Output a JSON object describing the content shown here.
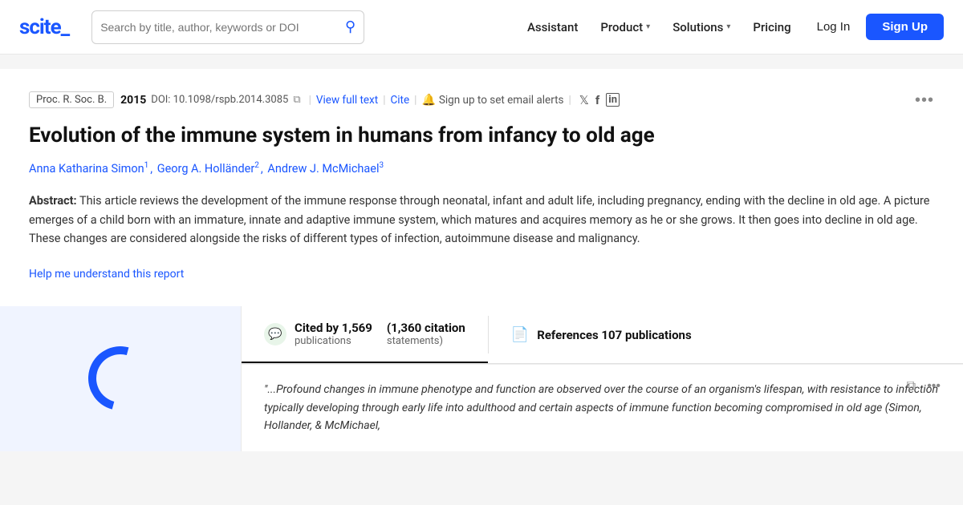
{
  "nav": {
    "logo": "scite_",
    "search": {
      "placeholder": "Search by title, author, keywords or DOI"
    },
    "links": [
      {
        "label": "Assistant",
        "hasDropdown": false
      },
      {
        "label": "Product",
        "hasDropdown": true
      },
      {
        "label": "Solutions",
        "hasDropdown": true
      },
      {
        "label": "Pricing",
        "hasDropdown": false
      }
    ],
    "login_label": "Log In",
    "signup_label": "Sign Up"
  },
  "article": {
    "journal": "Proc. R. Soc. B.",
    "year": "2015",
    "doi": "DOI: 10.1098/rspb.2014.3085",
    "view_full_text": "View full text",
    "cite": "Cite",
    "email_alert": "Sign up to set email alerts",
    "title": "Evolution of the immune system in humans from infancy to old age",
    "authors": [
      {
        "name": "Anna Katharina Simon",
        "sup": "1"
      },
      {
        "name": "Georg A. Holländer",
        "sup": "2"
      },
      {
        "name": "Andrew J. McMichael",
        "sup": "3"
      }
    ],
    "abstract_label": "Abstract:",
    "abstract_text": "This article reviews the development of the immune response through neonatal, infant and adult life, including pregnancy, ending with the decline in old age. A picture emerges of a child born with an immature, innate and adaptive immune system, which matures and acquires memory as he or she grows. It then goes into decline in old age. These changes are considered alongside the risks of different types of infection, autoimmune disease and malignancy.",
    "help_link": "Help me understand this report"
  },
  "citation_section": {
    "cited_by_label": "Cited by 1,569",
    "cited_by_sub": "publications",
    "citation_statements_label": "(1,360 citation",
    "citation_statements_sub": "statements)",
    "references_label": "References 107 publications",
    "citation_quote": "\"...Profound changes in immune phenotype and function are observed over the course of an organism's lifespan, with resistance to infection typically developing through early life into adulthood and certain aspects of immune function becoming compromised in old age (Simon, Hollander, & McMichael,"
  },
  "icons": {
    "search": "🔍",
    "chevron_down": "▾",
    "copy": "⧉",
    "bell": "🔔",
    "twitter": "𝕏",
    "facebook": "f",
    "linkedin": "in",
    "more": "•••",
    "chat_bubble": "💬",
    "document": "📄",
    "copy_action": "⧉",
    "more_action": "•••"
  }
}
